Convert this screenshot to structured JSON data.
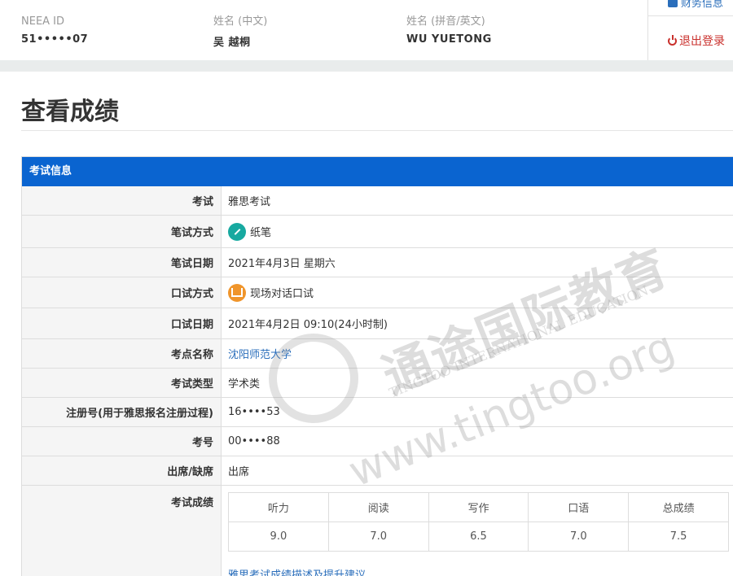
{
  "header": {
    "neea_label": "NEEA ID",
    "neea_value": "51•••••07",
    "name_cn_label": "姓名 (中文)",
    "name_cn_value": "吴  越桐",
    "name_en_label": "姓名 (拼音/英文)",
    "name_en_value": "WU YUETONG",
    "nav_finance": "财务信息",
    "nav_logout": "退出登录"
  },
  "page": {
    "title": "查看成绩"
  },
  "panel": {
    "heading": "考试信息",
    "rows": [
      {
        "key": "考试",
        "value": "雅思考试"
      },
      {
        "key": "笔试方式",
        "value": "纸笔"
      },
      {
        "key": "笔试日期",
        "value": "2021年4月3日 星期六"
      },
      {
        "key": "口试方式",
        "value": "现场对话口试"
      },
      {
        "key": "口试日期",
        "value": "2021年4月2日 09:10(24小时制)"
      },
      {
        "key": "考点名称",
        "value": "沈阳师范大学"
      },
      {
        "key": "考试类型",
        "value": "学术类"
      },
      {
        "key": "注册号(用于雅思报名注册过程)",
        "value": "16••••53"
      },
      {
        "key": "考号",
        "value": "00••••88"
      },
      {
        "key": "出席/缺席",
        "value": "出席"
      },
      {
        "key": "考试成绩",
        "value": ""
      }
    ],
    "scores": {
      "headers": [
        "听力",
        "阅读",
        "写作",
        "口语",
        "总成绩"
      ],
      "values": [
        "9.0",
        "7.0",
        "6.5",
        "7.0",
        "7.5"
      ]
    },
    "suggest_link": "雅思考试成绩描述及提升建议"
  },
  "watermark": {
    "cn": "通途国际教育",
    "en": "TINGTOO INTERNATIONAL EDUCATION",
    "url": "www.tingtoo.org"
  },
  "colors": {
    "panel_head": "#0a64d0",
    "link": "#2a6ebb",
    "logout": "#c9302c"
  }
}
